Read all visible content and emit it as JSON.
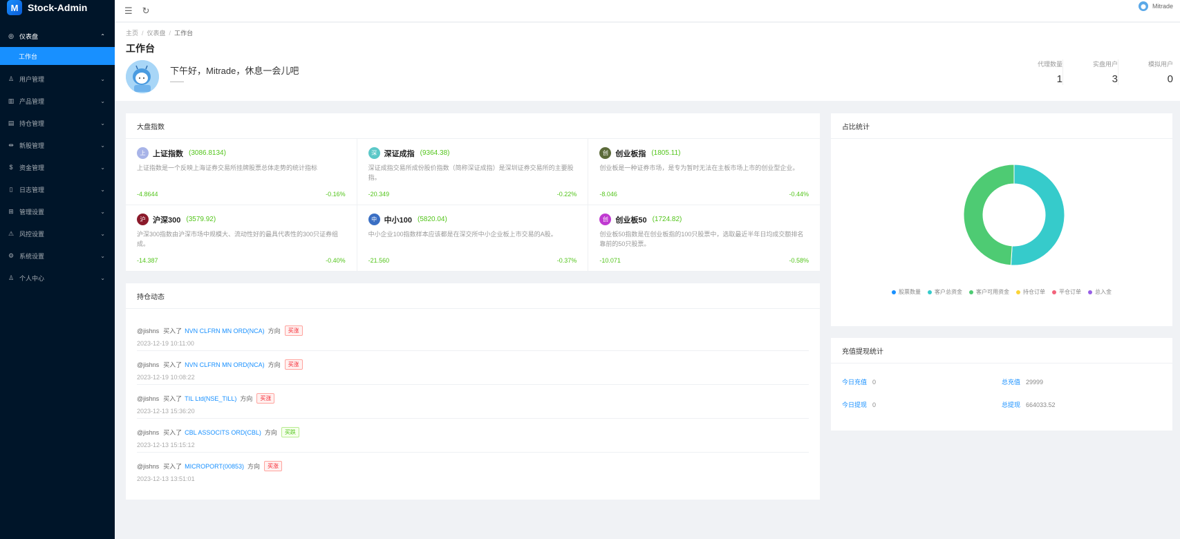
{
  "app": {
    "title": "Stock-Admin",
    "logo_glyph": "M"
  },
  "sidebar": {
    "items": [
      {
        "label": "仪表盘",
        "icon": "dashboard-icon",
        "glyph": "◎",
        "open": true,
        "arrow": "⌃"
      },
      {
        "label": "用户管理",
        "icon": "users-icon",
        "glyph": "♙",
        "arrow": "⌄"
      },
      {
        "label": "产品管理",
        "icon": "chart-icon",
        "glyph": "▥",
        "arrow": "⌄"
      },
      {
        "label": "持仓管理",
        "icon": "position-icon",
        "glyph": "▤",
        "arrow": "⌄"
      },
      {
        "label": "新股管理",
        "icon": "ipo-icon",
        "glyph": "⇹",
        "arrow": "⌄"
      },
      {
        "label": "资金管理",
        "icon": "money-icon",
        "glyph": "$",
        "arrow": "⌄"
      },
      {
        "label": "日志管理",
        "icon": "log-icon",
        "glyph": "▯",
        "arrow": "⌄"
      },
      {
        "label": "管理设置",
        "icon": "admin-settings-icon",
        "glyph": "⊞",
        "arrow": "⌄"
      },
      {
        "label": "风控设置",
        "icon": "warning-icon",
        "glyph": "⚠",
        "arrow": "⌄"
      },
      {
        "label": "系统设置",
        "icon": "gear-icon",
        "glyph": "⚙",
        "arrow": "⌄"
      },
      {
        "label": "个人中心",
        "icon": "user-icon",
        "glyph": "♙",
        "arrow": "⌄"
      }
    ],
    "submenu_active": "工作台"
  },
  "topbar": {
    "menu_glyph": "☰",
    "refresh_glyph": "↻",
    "username": "Mitrade"
  },
  "header": {
    "breadcrumb": [
      "主页",
      "仪表盘",
      "工作台"
    ],
    "title": "工作台",
    "greeting": "下午好，Mitrade，休息一会儿吧",
    "greeting_sub": "——",
    "stats": [
      {
        "label": "代理数量",
        "value": "1"
      },
      {
        "label": "实盘用户",
        "value": "3"
      },
      {
        "label": "模拟用户",
        "value": "0"
      }
    ]
  },
  "indices": {
    "title": "大盘指数",
    "items": [
      {
        "badge": "上",
        "color": "#a8b4e8",
        "name": "上证指数",
        "value": "(3086.8134)",
        "desc": "上证指数是一个反映上海证券交易所挂牌股票总体走势的统计指标",
        "change": "-4.8644",
        "pct": "-0.16%"
      },
      {
        "badge": "深",
        "color": "#5bc8c8",
        "name": "深证成指",
        "value": "(9364.38)",
        "desc": "深证成指交易所成份股价指数（简称深证成指）是深圳证券交易所的主要股指。",
        "change": "-20.349",
        "pct": "-0.22%"
      },
      {
        "badge": "创",
        "color": "#5c6b3a",
        "name": "创业板指",
        "value": "(1805.11)",
        "desc": "创业板是一种证券市场，是专为暂时无法在主板市场上市的创业型企业。",
        "change": "-8.046",
        "pct": "-0.44%"
      },
      {
        "badge": "沪",
        "color": "#8b1a2b",
        "name": "沪深300",
        "value": "(3579.92)",
        "desc": "沪深300指数由沪深市场中规模大、流动性好的最具代表性的300只证券组成。",
        "change": "-14.387",
        "pct": "-0.40%"
      },
      {
        "badge": "中",
        "color": "#3a6fc4",
        "name": "中小100",
        "value": "(5820.04)",
        "desc": "中小企业100指数样本应该都是在深交所中小企业板上市交易的A股。",
        "change": "-21.560",
        "pct": "-0.37%"
      },
      {
        "badge": "创",
        "color": "#c03ad1",
        "name": "创业板50",
        "value": "(1724.82)",
        "desc": "创业板50指数是在创业板指的100只股票中，选取最近半年日均成交额排名靠前的50只股票。",
        "change": "-10.071",
        "pct": "-0.58%"
      }
    ]
  },
  "feed": {
    "title": "持仓动态",
    "items": [
      {
        "user": "@jishns",
        "verb": "买入了",
        "stock": "NVN CLFRN MN ORD(NCA)",
        "dir_label": "方向",
        "tag": "买涨",
        "tag_type": "up",
        "time": "2023-12-19 10:11:00"
      },
      {
        "user": "@jishns",
        "verb": "买入了",
        "stock": "NVN CLFRN MN ORD(NCA)",
        "dir_label": "方向",
        "tag": "买涨",
        "tag_type": "up",
        "time": "2023-12-19 10:08:22"
      },
      {
        "user": "@jishns",
        "verb": "买入了",
        "stock": "TIL Ltd(NSE_TILL)",
        "dir_label": "方向",
        "tag": "买涨",
        "tag_type": "up",
        "time": "2023-12-13 15:36:20"
      },
      {
        "user": "@jishns",
        "verb": "买入了",
        "stock": "CBL ASSOCITS ORD(CBL)",
        "dir_label": "方向",
        "tag": "买跌",
        "tag_type": "down",
        "time": "2023-12-13 15:15:12"
      },
      {
        "user": "@jishns",
        "verb": "买入了",
        "stock": "MICROPORT(00853)",
        "dir_label": "方向",
        "tag": "买涨",
        "tag_type": "up",
        "time": "2023-12-13 13:51:01"
      }
    ]
  },
  "ratio": {
    "title": "占比统计"
  },
  "chart_data": {
    "type": "pie",
    "title": "占比统计",
    "donut": true,
    "legend_position": "bottom",
    "series": [
      {
        "name": "股票数量",
        "value": 0,
        "color": "#1890ff"
      },
      {
        "name": "客户总资金",
        "value": 51,
        "color": "#36cbcb"
      },
      {
        "name": "客户可用资金",
        "value": 49,
        "color": "#4ecb73"
      },
      {
        "name": "持仓订单",
        "value": 0,
        "color": "#fbd437"
      },
      {
        "name": "平仓订单",
        "value": 0,
        "color": "#f2637b"
      },
      {
        "name": "总入金",
        "value": 0,
        "color": "#975fe5"
      }
    ]
  },
  "funds": {
    "title": "充值提现统计",
    "items": [
      {
        "label": "今日充值",
        "value": "0"
      },
      {
        "label": "总充值",
        "value": "29999"
      },
      {
        "label": "今日提现",
        "value": "0"
      },
      {
        "label": "总提现",
        "value": "664033.52"
      }
    ]
  }
}
